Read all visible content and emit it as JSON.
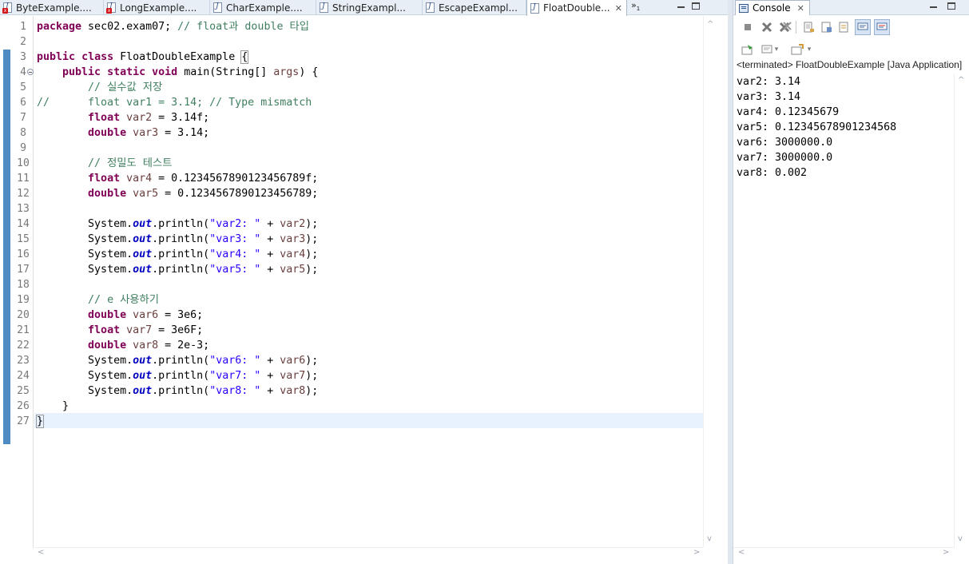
{
  "editor": {
    "tabs": [
      {
        "label": "ByteExample....",
        "error": true
      },
      {
        "label": "LongExample....",
        "error": true
      },
      {
        "label": "CharExample....",
        "error": false
      },
      {
        "label": "StringExampl...",
        "error": false
      },
      {
        "label": "EscapeExampl...",
        "error": false
      },
      {
        "label": "FloatDouble...",
        "error": false,
        "active": true
      }
    ],
    "overflow_label": "»",
    "overflow_count": "1",
    "line_numbers": [
      "1",
      "2",
      "3",
      "4",
      "5",
      "6",
      "7",
      "8",
      "9",
      "10",
      "11",
      "12",
      "13",
      "14",
      "15",
      "16",
      "17",
      "18",
      "19",
      "20",
      "21",
      "22",
      "23",
      "24",
      "25",
      "26",
      "27"
    ],
    "code": {
      "l1": {
        "kw": "package",
        "rest": " sec02.exam07; ",
        "cm": "// float과 double 타입"
      },
      "l3": {
        "kw1": "public",
        "kw2": "class",
        "name": " FloatDoubleExample ",
        "brace": "{"
      },
      "l4": {
        "kw1": "public",
        "kw2": "static",
        "kw3": "void",
        "rest": " main(String[] ",
        "param": "args",
        "end": ") {"
      },
      "l5": {
        "cm": "// 실수값 저장"
      },
      "l6": {
        "cm": "//      float var1 = 3.14; // Type mismatch"
      },
      "l7": {
        "kw": "float",
        "var": "var2",
        "rest": " = 3.14f;"
      },
      "l8": {
        "kw": "double",
        "var": "var3",
        "rest": " = 3.14;"
      },
      "l10": {
        "cm": "// 정밀도 테스트"
      },
      "l11": {
        "kw": "float",
        "var": "var4",
        "rest": " = 0.1234567890123456789f;"
      },
      "l12": {
        "kw": "double",
        "var": "var5",
        "rest": " = 0.1234567890123456789;"
      },
      "l14": {
        "pre": "System.",
        "field": "out",
        "mid": ".println(",
        "str": "\"var2: \"",
        "plus": " + ",
        "var": "var2",
        "end": ");"
      },
      "l15": {
        "pre": "System.",
        "field": "out",
        "mid": ".println(",
        "str": "\"var3: \"",
        "plus": " + ",
        "var": "var3",
        "end": ");"
      },
      "l16": {
        "pre": "System.",
        "field": "out",
        "mid": ".println(",
        "str": "\"var4: \"",
        "plus": " + ",
        "var": "var4",
        "end": ");"
      },
      "l17": {
        "pre": "System.",
        "field": "out",
        "mid": ".println(",
        "str": "\"var5: \"",
        "plus": " + ",
        "var": "var5",
        "end": ");"
      },
      "l19": {
        "cm": "// e 사용하기"
      },
      "l20": {
        "kw": "double",
        "var": "var6",
        "rest": " = 3e6;"
      },
      "l21": {
        "kw": "float",
        "var": "var7",
        "rest": " = 3e6F;"
      },
      "l22": {
        "kw": "double",
        "var": "var8",
        "rest": " = 2e-3;"
      },
      "l23": {
        "pre": "System.",
        "field": "out",
        "mid": ".println(",
        "str": "\"var6: \"",
        "plus": " + ",
        "var": "var6",
        "end": ");"
      },
      "l24": {
        "pre": "System.",
        "field": "out",
        "mid": ".println(",
        "str": "\"var7: \"",
        "plus": " + ",
        "var": "var7",
        "end": ");"
      },
      "l25": {
        "pre": "System.",
        "field": "out",
        "mid": ".println(",
        "str": "\"var8: \"",
        "plus": " + ",
        "var": "var8",
        "end": ");"
      },
      "l26": {
        "text": "}"
      },
      "l27": {
        "text": "}"
      }
    }
  },
  "console": {
    "tab_label": "Console",
    "status": "<terminated> FloatDoubleExample [Java Application]",
    "output": [
      "var2: 3.14",
      "var3: 3.14",
      "var4: 0.12345679",
      "var5: 0.12345678901234568",
      "var6: 3000000.0",
      "var7: 3000000.0",
      "var8: 0.002"
    ]
  },
  "icons": {
    "close": "✕",
    "scroll_up": "^",
    "scroll_down": "v",
    "scroll_left": "<",
    "scroll_right": ">",
    "dropdown": "▾"
  },
  "colors": {
    "keyword": "#7f0055",
    "comment": "#3f7f5f",
    "string": "#2a00ff",
    "field": "#0000c0",
    "local_var": "#6a3e3e",
    "current_line": "#e8f2fe",
    "ruler_marker": "#4f8bc3"
  }
}
